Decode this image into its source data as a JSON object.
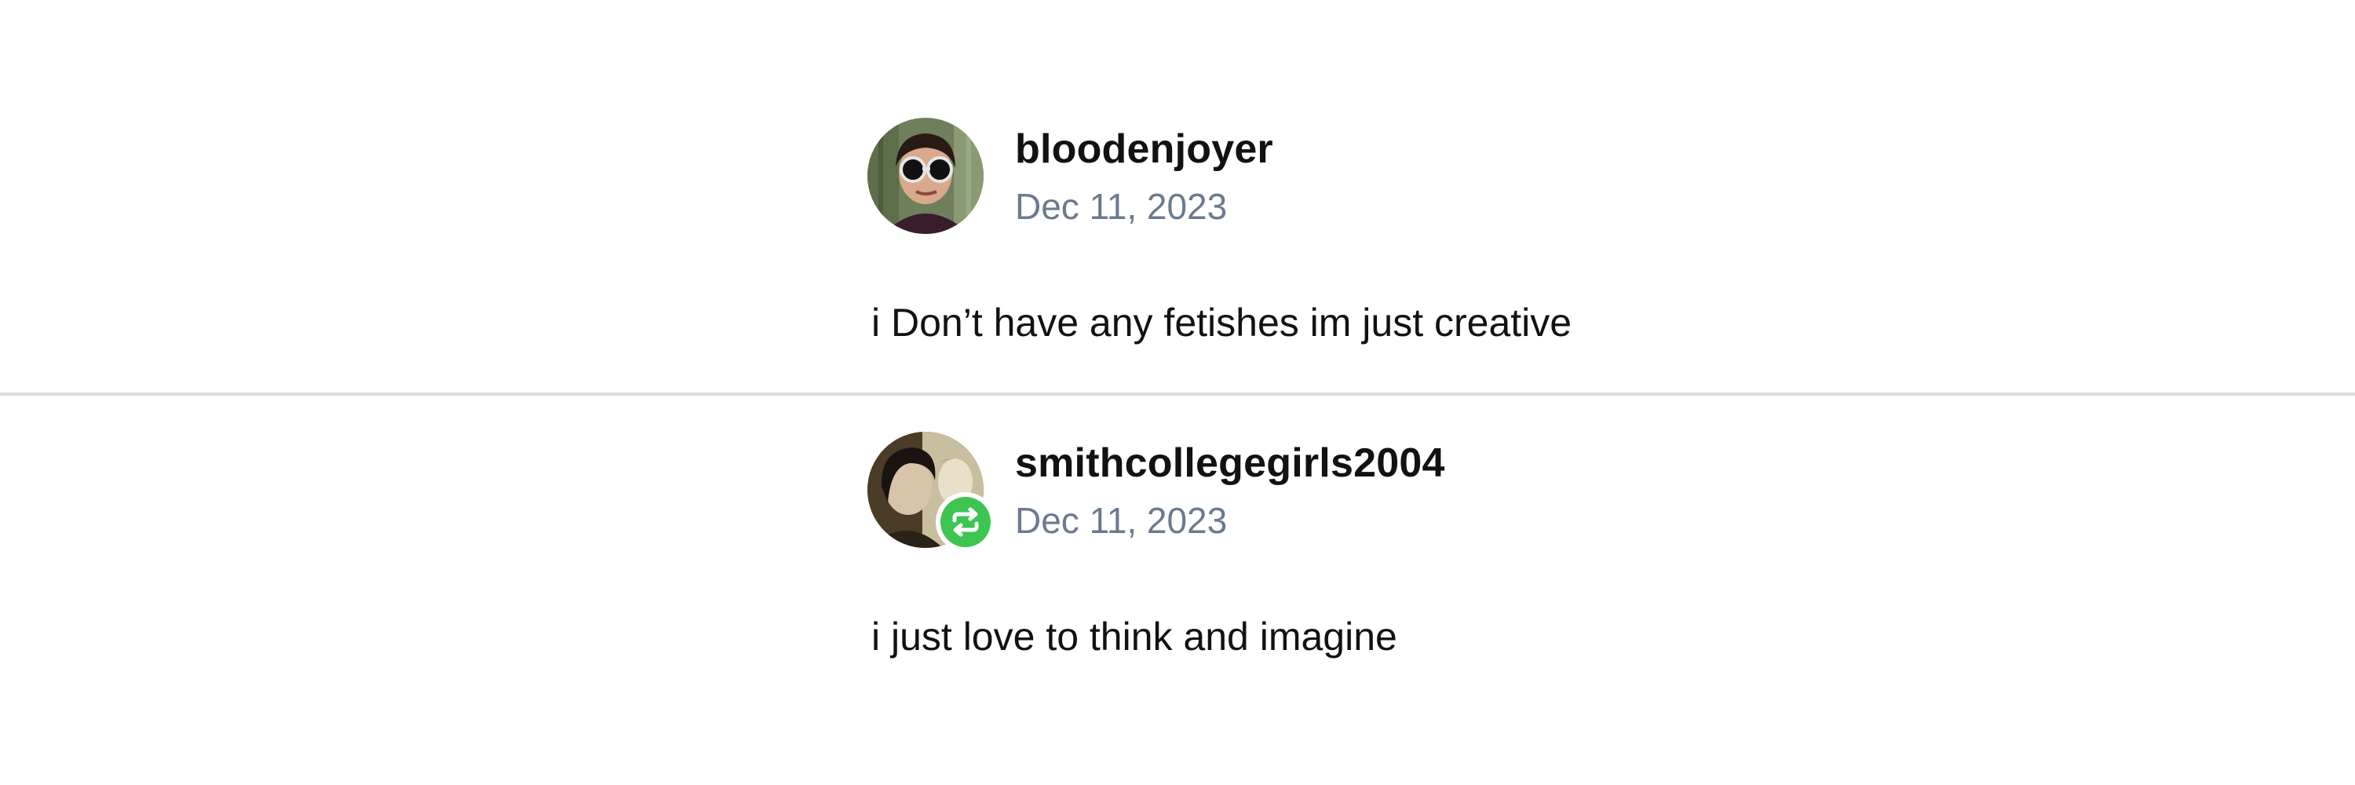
{
  "posts": [
    {
      "username": "bloodenjoyer",
      "date": "Dec 11, 2023",
      "body": "i Don’t have any fetishes im just creative",
      "reblogged": false
    },
    {
      "username": "smithcollegegirls2004",
      "date": "Dec 11, 2023",
      "body": "i just love to think and imagine",
      "reblogged": true
    }
  ],
  "colors": {
    "username": "#121212",
    "date": "#6b7a8f",
    "divider": "#dcdcdc",
    "reblog_badge": "#3ec450"
  },
  "icons": {
    "reblog": "reblog-icon"
  }
}
